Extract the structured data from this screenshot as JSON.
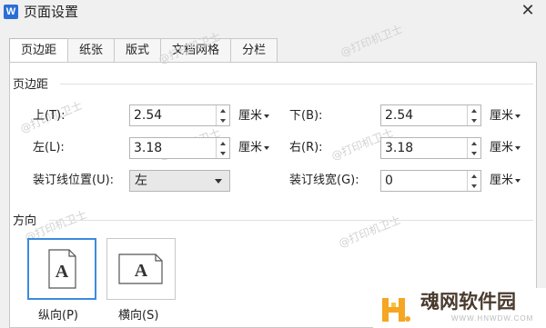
{
  "window": {
    "app_icon_letter": "W",
    "title": "页面设置"
  },
  "tabs": [
    "页边距",
    "纸张",
    "版式",
    "文档网格",
    "分栏"
  ],
  "margins": {
    "section_label": "页边距",
    "top": {
      "label": "上(T):",
      "value": "2.54",
      "unit": "厘米"
    },
    "bottom": {
      "label": "下(B):",
      "value": "2.54",
      "unit": "厘米"
    },
    "left": {
      "label": "左(L):",
      "value": "3.18",
      "unit": "厘米"
    },
    "right": {
      "label": "右(R):",
      "value": "3.18",
      "unit": "厘米"
    },
    "gutter_position": {
      "label": "装订线位置(U):",
      "value": "左"
    },
    "gutter_width": {
      "label": "装订线宽(G):",
      "value": "0",
      "unit": "厘米"
    }
  },
  "orientation": {
    "section_label": "方向",
    "portrait": {
      "label": "纵向(P)",
      "glyph": "A",
      "selected": true
    },
    "landscape": {
      "label": "横向(S)",
      "glyph": "A",
      "selected": false
    }
  },
  "watermark_text": "@打印机卫士",
  "brand": {
    "name": "魂网软件园",
    "url": "WWW.HNWDW.COM"
  },
  "colors": {
    "selected_border": "#3b8be0",
    "app_icon": "#2b6fd6"
  }
}
